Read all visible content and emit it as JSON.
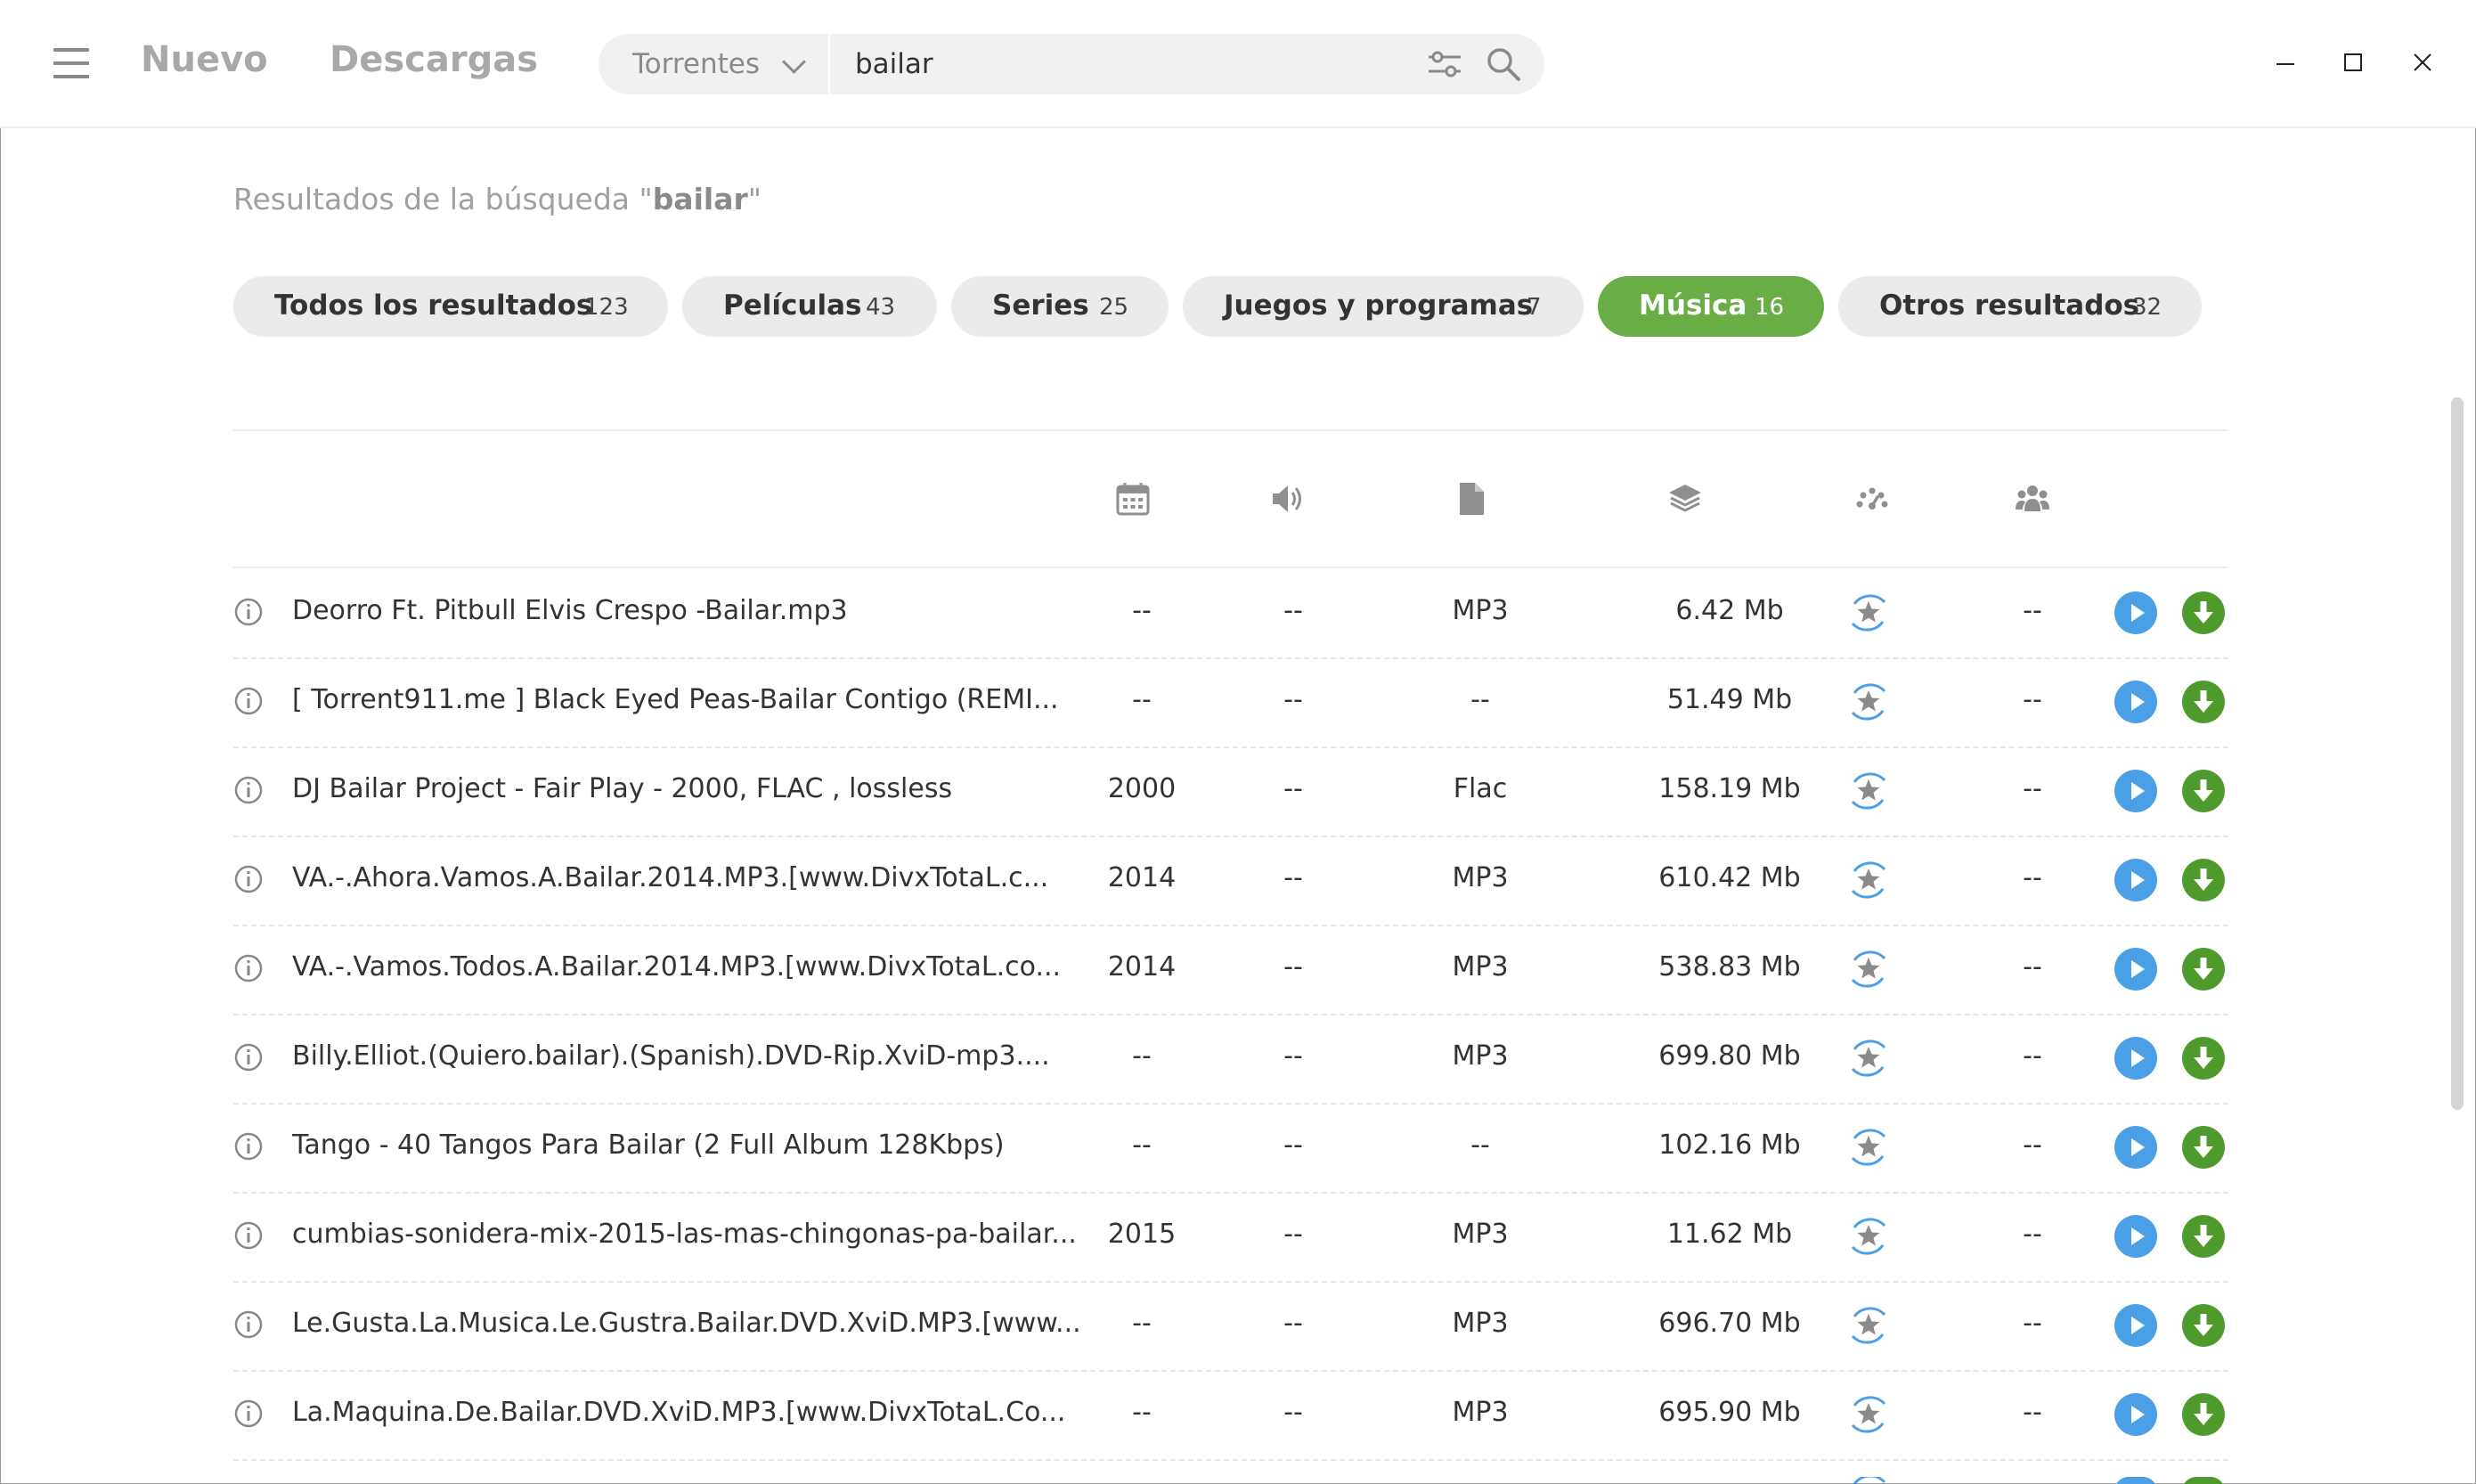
{
  "nav": {
    "new_label": "Nuevo",
    "downloads_label": "Descargas"
  },
  "search": {
    "category": "Torrentes",
    "query": "bailar"
  },
  "results": {
    "prefix": "Resultados de la búsqueda \"",
    "query": "bailar",
    "suffix": "\""
  },
  "tabs": [
    {
      "label": "Todos los resultados",
      "count": "123",
      "active": false
    },
    {
      "label": "Películas",
      "count": "43",
      "active": false
    },
    {
      "label": "Series",
      "count": "25",
      "active": false
    },
    {
      "label": "Juegos y programas",
      "count": "7",
      "active": false
    },
    {
      "label": "Música",
      "count": "16",
      "active": true
    },
    {
      "label": "Otros resultados",
      "count": "32",
      "active": false
    }
  ],
  "columns": [
    "calendar-icon",
    "speaker-icon",
    "file-icon",
    "layers-icon",
    "speedometer-icon",
    "people-icon"
  ],
  "colors": {
    "accent_green": "#69ad45",
    "play_blue": "#4a9fe6",
    "download_green": "#4f9a2c",
    "rating_blue": "#4a9fe6"
  },
  "rows": [
    {
      "name": "Deorro Ft. Pitbull Elvis Crespo -Bailar.mp3",
      "year": "--",
      "audio": "--",
      "format": "MP3",
      "size": "6.42 Mb",
      "peers": "--"
    },
    {
      "name": "[ Torrent911.me ] Black Eyed Peas-Bailar Contigo (REMI...",
      "year": "--",
      "audio": "--",
      "format": "--",
      "size": "51.49 Mb",
      "peers": "--"
    },
    {
      "name": "DJ Bailar Project - Fair Play  - 2000, FLAC , lossless",
      "year": "2000",
      "audio": "--",
      "format": "Flac",
      "size": "158.19 Mb",
      "peers": "--"
    },
    {
      "name": "VA.-.Ahora.Vamos.A.Bailar.2014.MP3.[www.DivxTotaL.c...",
      "year": "2014",
      "audio": "--",
      "format": "MP3",
      "size": "610.42 Mb",
      "peers": "--"
    },
    {
      "name": "VA.-.Vamos.Todos.A.Bailar.2014.MP3.[www.DivxTotaL.co...",
      "year": "2014",
      "audio": "--",
      "format": "MP3",
      "size": "538.83 Mb",
      "peers": "--"
    },
    {
      "name": "Billy.Elliot.(Quiero.bailar).(Spanish).DVD-Rip.XviD-mp3....",
      "year": "--",
      "audio": "--",
      "format": "MP3",
      "size": "699.80 Mb",
      "peers": "--"
    },
    {
      "name": "Tango - 40 Tangos Para Bailar (2 Full Album 128Kbps)",
      "year": "--",
      "audio": "--",
      "format": "--",
      "size": "102.16 Mb",
      "peers": "--"
    },
    {
      "name": "cumbias-sonidera-mix-2015-las-mas-chingonas-pa-bailar...",
      "year": "2015",
      "audio": "--",
      "format": "MP3",
      "size": "11.62 Mb",
      "peers": "--"
    },
    {
      "name": "Le.Gusta.La.Musica.Le.Gustra.Bailar.DVD.XviD.MP3.[www...",
      "year": "--",
      "audio": "--",
      "format": "MP3",
      "size": "696.70 Mb",
      "peers": "--"
    },
    {
      "name": "La.Maquina.De.Bailar.DVD.XviD.MP3.[www.DivxTotaL.Co...",
      "year": "--",
      "audio": "--",
      "format": "MP3",
      "size": "695.90 Mb",
      "peers": "--"
    }
  ]
}
